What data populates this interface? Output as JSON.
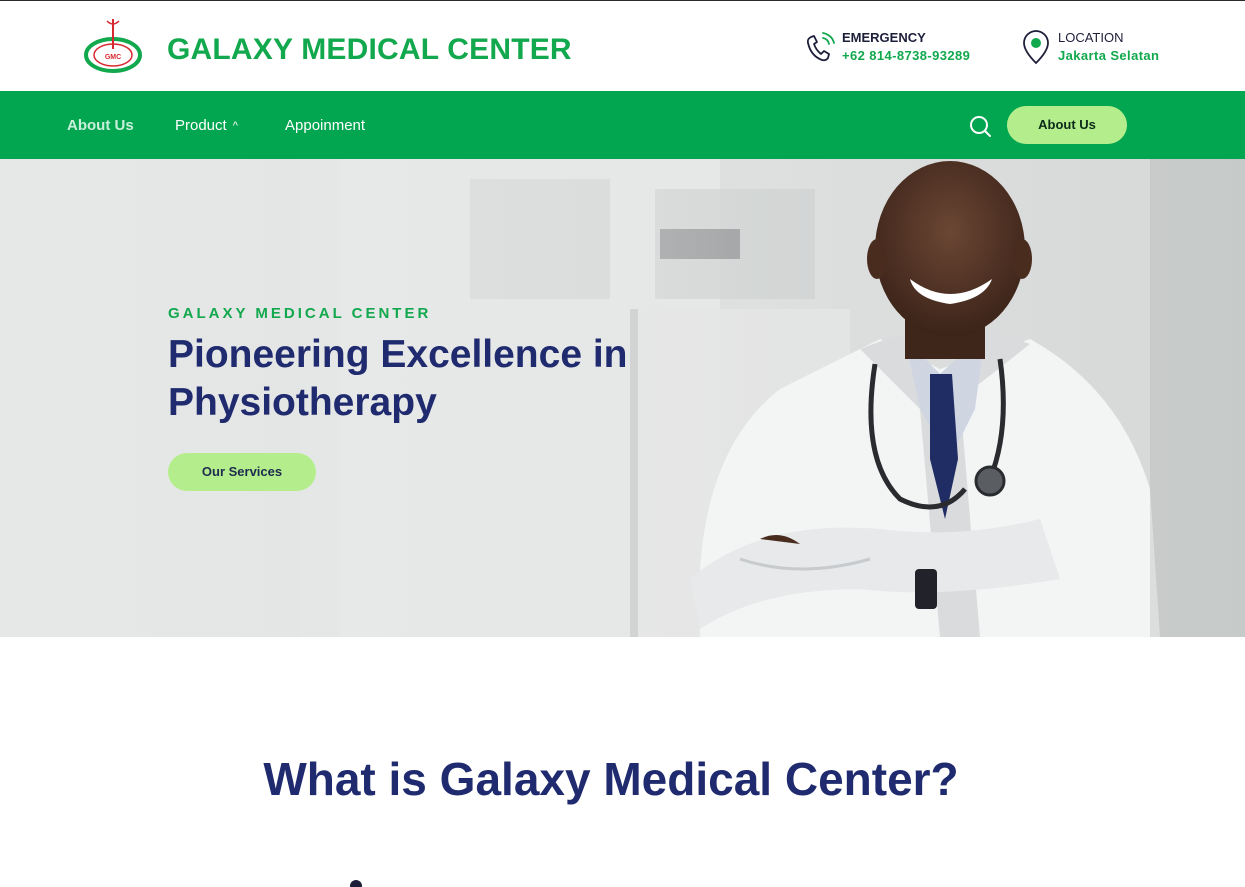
{
  "header": {
    "brand": "GALAXY MEDICAL CENTER",
    "logo_text": "GMC",
    "emergency": {
      "label": "EMERGENCY",
      "value": "+62 814-8738-93289",
      "icon": "phone-ring-icon"
    },
    "location": {
      "label": "LOCATION",
      "value": "Jakarta Selatan",
      "icon": "map-pin-icon"
    }
  },
  "nav": {
    "items": [
      {
        "label": "About Us",
        "active": true
      },
      {
        "label": "Product",
        "has_dropdown": true,
        "chevron": "^"
      },
      {
        "label": "Appoinment"
      }
    ],
    "search_icon": "search-icon",
    "cta_label": "About Us"
  },
  "hero": {
    "eyebrow": "GALAXY MEDICAL CENTER",
    "title": "Pioneering Excellence in Physiotherapy",
    "button_label": "Our Services",
    "image": "smiling doctor photo"
  },
  "section": {
    "title": "What is Galaxy Medical Center?"
  },
  "colors": {
    "brand_green": "#12a84d",
    "nav_green": "#03a650",
    "accent_light_green": "#b4ee8c",
    "navy": "#1f2b6e"
  }
}
